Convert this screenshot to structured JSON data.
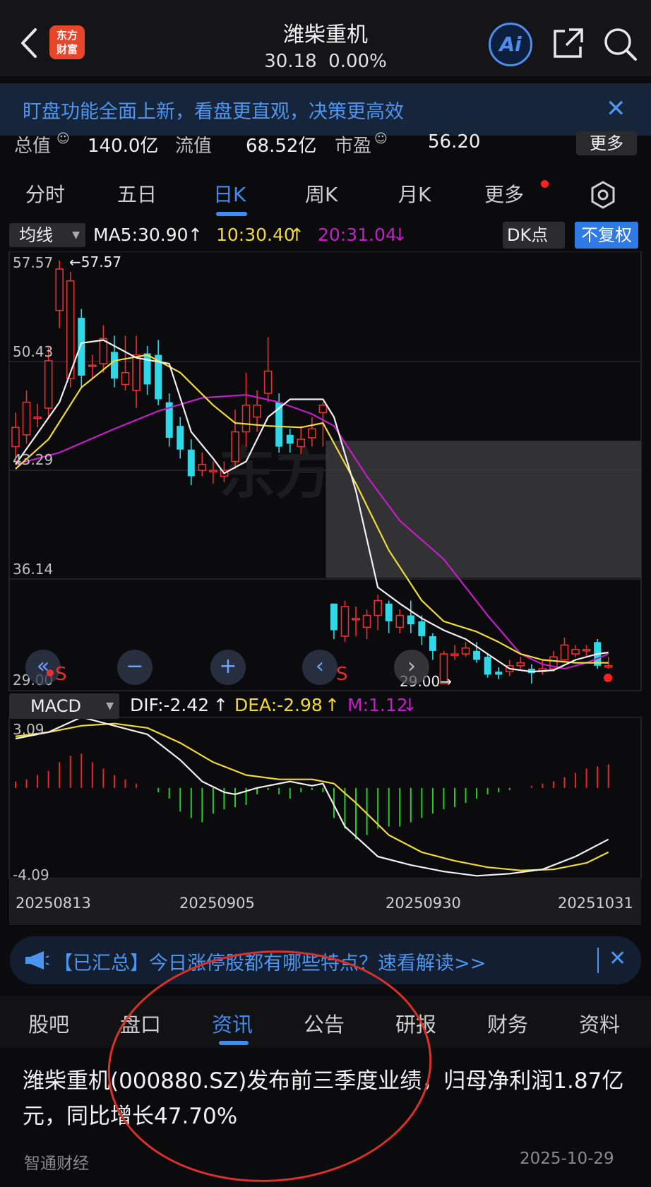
{
  "header": {
    "back_icon": "chevron-left-icon",
    "logo_line1": "东方",
    "logo_line2": "财富",
    "title": "潍柴重机",
    "price": "30.18",
    "change": "0.00%",
    "ai_label": "Ai",
    "share_icon": "share-icon",
    "search_icon": "search-icon"
  },
  "banner": {
    "text": "盯盘功能全面上新，看盘更直观，决策更高效",
    "close": "✕"
  },
  "stats": {
    "market_cap_label": "总值",
    "market_cap_value": "140.0亿",
    "float_label": "流值",
    "float_value": "68.52亿",
    "pe_label": "市盈",
    "pe_value": "56.20",
    "more_label": "更多"
  },
  "period_tabs": [
    {
      "label": "分时",
      "active": false
    },
    {
      "label": "五日",
      "active": false
    },
    {
      "label": "日K",
      "active": true
    },
    {
      "label": "周K",
      "active": false
    },
    {
      "label": "月K",
      "active": false
    },
    {
      "label": "更多",
      "active": false
    }
  ],
  "ma_row": {
    "select_label": "均线",
    "ma5": "MA5:30.90",
    "ma10": "10:30.40",
    "ma20": "20:31.04",
    "dk_label": "DK点",
    "fq_label": "不复权"
  },
  "macd_row": {
    "select_label": "MACD",
    "dif": "DIF:-2.42",
    "dea": "DEA:-2.98",
    "m": "M:1.12"
  },
  "colors": {
    "up": "#e83030",
    "down": "#2ed8e6",
    "ma5": "#f0f0f0",
    "ma10": "#f0da3a",
    "ma20": "#c31ec8",
    "accent": "#3f8cf2",
    "hist_up": "#e82828",
    "hist_down": "#27cc2c"
  },
  "chart_data": [
    {
      "type": "candlestick",
      "title": "",
      "y_ticks": [
        "57.57",
        "50.43",
        "43.29",
        "36.14",
        "29.00"
      ],
      "ylim": [
        29.0,
        57.57
      ],
      "max_label": "57.57",
      "min_label": "29.00",
      "x_ticks": [
        "20250813",
        "20250905",
        "20250930",
        "20251031"
      ],
      "candles": [
        {
          "o": 45.0,
          "c": 46.3,
          "h": 47.3,
          "l": 44.0
        },
        {
          "o": 45.8,
          "c": 48.0,
          "h": 48.8,
          "l": 45.2
        },
        {
          "o": 47.0,
          "c": 47.0,
          "h": 47.9,
          "l": 46.3
        },
        {
          "o": 47.6,
          "c": 50.8,
          "h": 51.7,
          "l": 47.0
        },
        {
          "o": 54.2,
          "c": 57.0,
          "h": 57.57,
          "l": 53.0
        },
        {
          "o": 49.6,
          "c": 56.2,
          "h": 56.8,
          "l": 49.0
        },
        {
          "o": 53.7,
          "c": 49.8,
          "h": 54.3,
          "l": 49.0
        },
        {
          "o": 50.5,
          "c": 50.5,
          "h": 51.2,
          "l": 49.6
        },
        {
          "o": 50.6,
          "c": 52.3,
          "h": 53.2,
          "l": 50.0
        },
        {
          "o": 51.4,
          "c": 49.6,
          "h": 52.5,
          "l": 49.0
        },
        {
          "o": 49.2,
          "c": 50.0,
          "h": 52.5,
          "l": 48.8
        },
        {
          "o": 48.8,
          "c": 51.2,
          "h": 52.5,
          "l": 47.6
        },
        {
          "o": 51.3,
          "c": 49.2,
          "h": 51.8,
          "l": 48.5
        },
        {
          "o": 51.2,
          "c": 48.2,
          "h": 52.2,
          "l": 47.8
        },
        {
          "o": 48.0,
          "c": 45.6,
          "h": 48.6,
          "l": 45.0
        },
        {
          "o": 46.4,
          "c": 44.8,
          "h": 47.0,
          "l": 44.2
        },
        {
          "o": 44.8,
          "c": 43.0,
          "h": 45.5,
          "l": 42.4
        },
        {
          "o": 43.4,
          "c": 43.8,
          "h": 44.6,
          "l": 43.0
        },
        {
          "o": 43.4,
          "c": 43.4,
          "h": 44.0,
          "l": 42.5
        },
        {
          "o": 43.0,
          "c": 43.4,
          "h": 44.0,
          "l": 42.6
        },
        {
          "o": 44.0,
          "c": 46.0,
          "h": 47.5,
          "l": 43.5
        },
        {
          "o": 46.0,
          "c": 47.8,
          "h": 50.0,
          "l": 45.0
        },
        {
          "o": 47.0,
          "c": 47.8,
          "h": 48.8,
          "l": 46.0
        },
        {
          "o": 48.6,
          "c": 50.1,
          "h": 52.4,
          "l": 48.0
        },
        {
          "o": 48.0,
          "c": 45.0,
          "h": 48.6,
          "l": 44.6
        },
        {
          "o": 45.8,
          "c": 45.2,
          "h": 46.2,
          "l": 44.6
        },
        {
          "o": 45.0,
          "c": 45.5,
          "h": 46.4,
          "l": 44.5
        },
        {
          "o": 45.6,
          "c": 46.2,
          "h": 47.0,
          "l": 45.0
        },
        {
          "o": 47.3,
          "c": 47.8,
          "h": 48.0,
          "l": 45.0
        },
        {
          "o": 34.4,
          "c": 32.6,
          "h": 34.4,
          "l": 32.0
        },
        {
          "o": 32.2,
          "c": 34.2,
          "h": 34.6,
          "l": 31.8
        },
        {
          "o": 33.4,
          "c": 33.4,
          "h": 34.2,
          "l": 32.2
        },
        {
          "o": 32.8,
          "c": 33.6,
          "h": 34.0,
          "l": 32.0
        },
        {
          "o": 33.6,
          "c": 34.6,
          "h": 35.0,
          "l": 32.6
        },
        {
          "o": 34.4,
          "c": 33.2,
          "h": 34.6,
          "l": 32.4
        },
        {
          "o": 32.8,
          "c": 33.6,
          "h": 34.0,
          "l": 32.4
        },
        {
          "o": 33.6,
          "c": 33.0,
          "h": 34.6,
          "l": 32.4
        },
        {
          "o": 33.2,
          "c": 32.2,
          "h": 33.6,
          "l": 31.6
        },
        {
          "o": 32.2,
          "c": 31.2,
          "h": 32.4,
          "l": 30.6
        },
        {
          "o": 29.0,
          "c": 31.0,
          "h": 31.2,
          "l": 29.0
        },
        {
          "o": 30.9,
          "c": 31.0,
          "h": 31.6,
          "l": 30.6
        },
        {
          "o": 31.0,
          "c": 31.4,
          "h": 31.8,
          "l": 30.8
        },
        {
          "o": 31.2,
          "c": 30.6,
          "h": 31.8,
          "l": 30.4
        },
        {
          "o": 30.8,
          "c": 29.6,
          "h": 31.0,
          "l": 29.4
        },
        {
          "o": 29.8,
          "c": 29.6,
          "h": 30.1,
          "l": 29.3
        },
        {
          "o": 29.8,
          "c": 30.2,
          "h": 30.6,
          "l": 29.5
        },
        {
          "o": 30.2,
          "c": 30.4,
          "h": 30.8,
          "l": 30.0
        },
        {
          "o": 30.0,
          "c": 29.7,
          "h": 30.3,
          "l": 29.0
        },
        {
          "o": 29.8,
          "c": 30.0,
          "h": 30.6,
          "l": 29.6
        },
        {
          "o": 30.0,
          "c": 30.8,
          "h": 31.2,
          "l": 29.8
        },
        {
          "o": 30.6,
          "c": 31.6,
          "h": 32.1,
          "l": 30.4
        },
        {
          "o": 31.0,
          "c": 31.3,
          "h": 31.6,
          "l": 30.8
        },
        {
          "o": 31.2,
          "c": 31.3,
          "h": 31.6,
          "l": 30.8
        },
        {
          "o": 31.8,
          "c": 30.2,
          "h": 32.0,
          "l": 30.0
        },
        {
          "o": 30.2,
          "c": 30.2,
          "h": 30.8,
          "l": 30.0
        }
      ],
      "ma5_pts": [
        [
          0,
          43.8
        ],
        [
          4,
          48.0
        ],
        [
          6,
          52.0
        ],
        [
          8,
          52.2
        ],
        [
          11,
          51.0
        ],
        [
          14,
          50.6
        ],
        [
          16,
          46.0
        ],
        [
          18,
          44.2
        ],
        [
          19,
          43.2
        ],
        [
          21,
          44.0
        ],
        [
          23,
          47.0
        ],
        [
          25,
          48.2
        ],
        [
          28,
          48.2
        ],
        [
          29,
          47.0
        ],
        [
          31,
          42.0
        ],
        [
          33,
          35.5
        ],
        [
          35,
          34.4
        ],
        [
          37,
          33.4
        ],
        [
          39,
          32.6
        ],
        [
          41,
          32.0
        ],
        [
          43,
          31.0
        ],
        [
          45,
          30.0
        ],
        [
          47,
          29.8
        ],
        [
          49,
          29.9
        ],
        [
          51,
          30.6
        ],
        [
          53,
          31.0
        ],
        [
          54,
          31.1
        ]
      ],
      "ma10_pts": [
        [
          0,
          43.5
        ],
        [
          3,
          45.5
        ],
        [
          6,
          49.0
        ],
        [
          9,
          50.8
        ],
        [
          12,
          51.2
        ],
        [
          15,
          50.0
        ],
        [
          18,
          47.8
        ],
        [
          20,
          46.6
        ],
        [
          23,
          46.4
        ],
        [
          26,
          46.3
        ],
        [
          28,
          46.6
        ],
        [
          31,
          42.5
        ],
        [
          34,
          38.0
        ],
        [
          37,
          34.6
        ],
        [
          39,
          33.2
        ],
        [
          42,
          32.5
        ],
        [
          44,
          31.8
        ],
        [
          46,
          31.0
        ],
        [
          48,
          30.6
        ],
        [
          51,
          30.4
        ],
        [
          54,
          30.4
        ]
      ],
      "ma20_pts": [
        [
          0,
          43.8
        ],
        [
          4,
          44.6
        ],
        [
          9,
          46.2
        ],
        [
          13,
          47.4
        ],
        [
          17,
          48.3
        ],
        [
          21,
          48.5
        ],
        [
          24,
          48.0
        ],
        [
          27,
          47.2
        ],
        [
          29,
          46.4
        ],
        [
          32,
          43.0
        ],
        [
          35,
          40.0
        ],
        [
          39,
          37.4
        ],
        [
          43,
          33.6
        ],
        [
          46,
          31.0
        ],
        [
          48,
          30.3
        ],
        [
          50,
          30.0
        ],
        [
          52,
          30.4
        ],
        [
          54,
          31.0
        ]
      ],
      "shaded_region": {
        "from": 28,
        "to": 54,
        "y_low": 36.14,
        "y_high": 45.4
      }
    },
    {
      "type": "macd",
      "y_ticks": [
        "3.09",
        "-4.09"
      ],
      "ylim": [
        -4.09,
        3.09
      ],
      "dif_pts": [
        [
          0,
          2.3
        ],
        [
          3,
          2.6
        ],
        [
          6,
          3.3
        ],
        [
          9,
          2.9
        ],
        [
          12,
          2.5
        ],
        [
          15,
          1.3
        ],
        [
          17,
          0.3
        ],
        [
          19,
          -0.2
        ],
        [
          20,
          -0.3
        ],
        [
          22,
          0.0
        ],
        [
          25,
          0.3
        ],
        [
          27,
          0.1
        ],
        [
          28,
          0.2
        ],
        [
          30,
          -1.8
        ],
        [
          33,
          -3.2
        ],
        [
          36,
          -3.6
        ],
        [
          39,
          -3.9
        ],
        [
          42,
          -4.1
        ],
        [
          45,
          -4.0
        ],
        [
          48,
          -3.8
        ],
        [
          51,
          -3.2
        ],
        [
          54,
          -2.4
        ]
      ],
      "dea_pts": [
        [
          0,
          2.4
        ],
        [
          3,
          2.6
        ],
        [
          6,
          2.9
        ],
        [
          9,
          3.0
        ],
        [
          12,
          2.8
        ],
        [
          15,
          2.1
        ],
        [
          18,
          1.2
        ],
        [
          21,
          0.6
        ],
        [
          24,
          0.4
        ],
        [
          27,
          0.4
        ],
        [
          29,
          0.2
        ],
        [
          31,
          -0.7
        ],
        [
          34,
          -2.2
        ],
        [
          37,
          -3.0
        ],
        [
          40,
          -3.4
        ],
        [
          43,
          -3.7
        ],
        [
          46,
          -3.85
        ],
        [
          49,
          -3.8
        ],
        [
          52,
          -3.5
        ],
        [
          54,
          -3.0
        ]
      ],
      "histogram": [
        0.3,
        0.4,
        0.6,
        0.8,
        1.2,
        1.5,
        1.6,
        1.2,
        0.9,
        0.6,
        0.4,
        0.2,
        0.0,
        -0.2,
        -0.5,
        -1.1,
        -1.4,
        -1.6,
        -1.2,
        -1.0,
        -0.9,
        -0.8,
        -0.3,
        -0.1,
        -0.3,
        -0.5,
        -0.2,
        -0.1,
        -0.2,
        -1.4,
        -1.9,
        -2.4,
        -2.2,
        -1.9,
        -1.8,
        -1.8,
        -1.6,
        -1.4,
        -1.2,
        -1.0,
        -0.9,
        -0.7,
        -0.5,
        -0.3,
        -0.2,
        -0.1,
        0.0,
        0.1,
        0.2,
        0.3,
        0.5,
        0.7,
        0.9,
        1.0,
        1.1
      ]
    }
  ],
  "controls": {
    "first_icon": "double-chevron-left-icon",
    "zoom_out_icon": "minus-icon",
    "zoom_in_icon": "plus-icon",
    "prev_icon": "chevron-left-icon",
    "next_icon": "chevron-right-icon",
    "s_marker": "S"
  },
  "info_banner": {
    "icon": "megaphone-icon",
    "text": "【已汇总】今日涨停股都有哪些特点？速看解读>>",
    "close": "✕"
  },
  "bottom_tabs": [
    {
      "label": "股吧",
      "active": false
    },
    {
      "label": "盘口",
      "active": false
    },
    {
      "label": "资讯",
      "active": true
    },
    {
      "label": "公告",
      "active": false
    },
    {
      "label": "研报",
      "active": false
    },
    {
      "label": "财务",
      "active": false
    },
    {
      "label": "资料",
      "active": false
    }
  ],
  "news": {
    "title": "潍柴重机(000880.SZ)发布前三季度业绩，归母净利润1.87亿元，同比增长47.70%",
    "source": "智通财经",
    "date": "2025-10-29"
  }
}
